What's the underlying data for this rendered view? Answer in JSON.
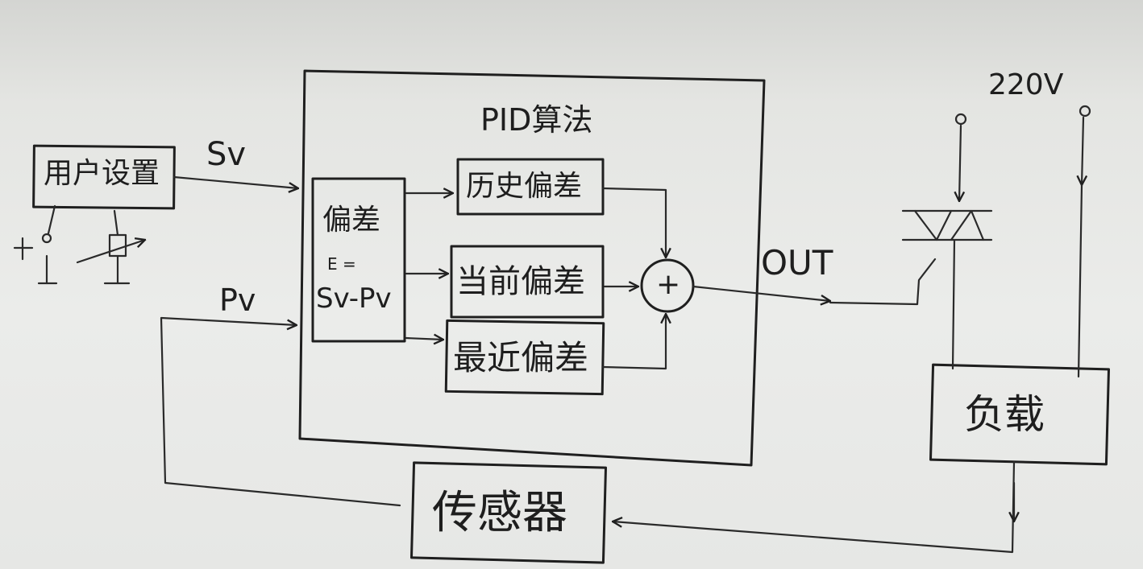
{
  "diagram": {
    "algorithm_title": "PID算法",
    "user_setting": "用户设置",
    "signals": {
      "sv": "Sv",
      "pv": "Pv",
      "out": "OUT"
    },
    "error_block": {
      "title": "偏差",
      "formula_line1": "E =",
      "formula_line2": "Sv-Pv"
    },
    "history_error": "历史偏差",
    "current_error": "当前偏差",
    "recent_error": "最近偏差",
    "summer": "+",
    "supply": "220V",
    "load": "负载",
    "sensor": "传感器"
  }
}
